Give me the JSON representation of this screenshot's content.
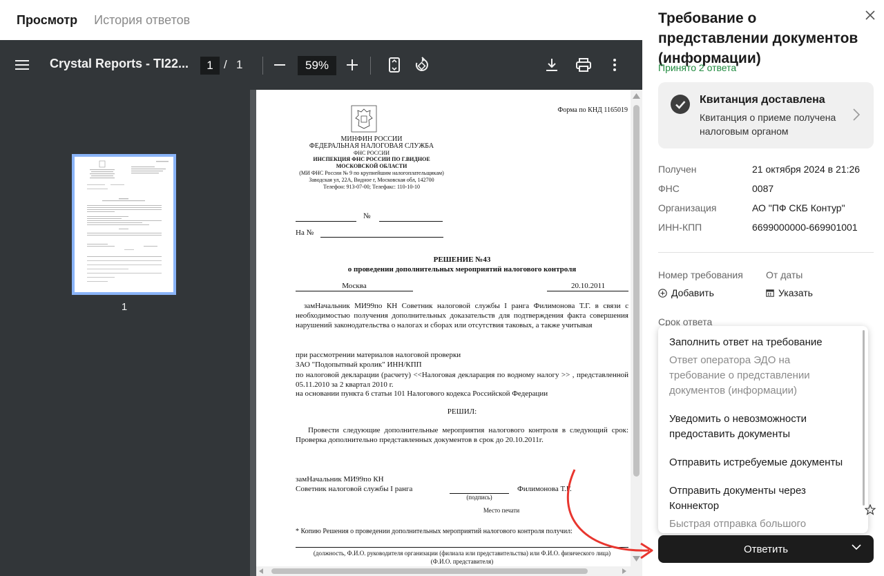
{
  "tabs": [
    {
      "label": "Просмотр",
      "active": true
    },
    {
      "label": "История ответов",
      "active": false
    }
  ],
  "viewer": {
    "title": "Crystal Reports - TI22...",
    "page_current": "1",
    "page_separator": "/",
    "page_total": "1",
    "zoom": "59%",
    "thumbnail_number": "1",
    "icons": [
      "menu-icon",
      "zoom-out-icon",
      "zoom-in-icon",
      "fit-page-icon",
      "rotate-icon",
      "download-icon",
      "print-icon",
      "more-icon"
    ]
  },
  "document": {
    "form_code": "Форма по КНД 1165019",
    "ministry": "МИНФИН РОССИИ",
    "service": "ФЕДЕРАЛЬНАЯ НАЛОГОВАЯ СЛУЖБА",
    "fns": "ФНС РОССИИ",
    "inspection_line1": "ИНСПЕКЦИЯ ФНС РОССИИ ПО Г.ВИДНОЕ",
    "inspection_line2": "МОСКОВСКОЙ ОБЛАСТИ",
    "inspection_line3": "(МИ ФНС России № 9  по крупнейшим налогоплательщикам)",
    "address": "Заводская ул, 22А, Видное г, Московская обл, 142700",
    "phone": "Телефон: 913-07-00; Телефакс: 110-10-10",
    "number_sign": "№",
    "to_label": "На  №",
    "decision_title": "РЕШЕНИЕ №43",
    "decision_subtitle": "о проведении дополнительных мероприятий налогового контроля",
    "city": "Москва",
    "date": "20.10.2011",
    "para1": "замНачальник МИ99по КН Советник налоговой службы I ранга Филимонова Т.Г. в связи с необходимостью получения дополнительных доказательств для подтверждения факта совершения нарушений законодательства о налогах и сборах  или отсутствия таковых, а также учитывая",
    "para2_line1": "при рассмотрении материалов налоговой проверки",
    "para2_line2": "ЗАО \"Подопытный кролик\"  ИНН/КПП",
    "para2_line3": "по налоговой декларации (расчету) <<Налоговая декларация по водному налогу >> , представленной  05.11.2010  за 2 квартал  2010 г.",
    "para2_line4": "на основании пункта 6 статьи 101 Налогового кодекса Российской Федерации",
    "resolved": "РЕШИЛ:",
    "para3": "Провести следующие дополнительные мероприятия налогового контроля в следующий срок: Проверка дополнительно представленных документов в срок до 20.10.2011г.",
    "signer_line1": "замНачальник МИ99по КН",
    "signer_line2": "Советник налоговой службы I ранга",
    "signer_name": "Филимонова Т.Г.",
    "signature_caption": "(подпись)",
    "stamp_place": "Место печати",
    "copy_note": "* Копию Решения о проведении дополнительных мероприятий налогового контроля получил:",
    "position_caption": "(должность, Ф.И.О. руководителя организации (филиала или представительства) или Ф.И.О. физического лица)",
    "rep_caption": "(Ф.И.О. представителя)"
  },
  "panel": {
    "title": "Требование о представлении документов (информации)",
    "accepted": "Принято 2 ответа",
    "receipt": {
      "title": "Квитанция доставлена",
      "subtitle": "Квитанция о приеме получена налоговым органом"
    },
    "info": [
      {
        "label": "Получен",
        "value": "21 октября 2024 в 21:26"
      },
      {
        "label": "ФНС",
        "value": "0087"
      },
      {
        "label": "Организация",
        "value": "АО \"ПФ СКБ Контур\""
      },
      {
        "label": "ИНН-КПП",
        "value": "6699000000-669901001"
      }
    ],
    "request_number_label": "Номер требования",
    "request_number_action": "Добавить",
    "date_label": "От даты",
    "date_action": "Указать",
    "deadline_label": "Срок ответа",
    "menu": [
      {
        "label": "Заполнить ответ на требование",
        "sub": "Ответ оператора ЭДО на требование о представлении документов (информации)"
      },
      {
        "label": "Уведомить о невозможности предоставить документы",
        "sub": ""
      },
      {
        "label": "Отправить истребуемые документы",
        "sub": ""
      },
      {
        "label": "Отправить документы через Коннектор",
        "sub": "Быстрая отправка большого"
      }
    ],
    "reply_button": "Ответить",
    "colors": {
      "accent_green": "#1f8a3e",
      "button_dark": "#1c1c1c",
      "arrow_red": "#e8362f"
    }
  }
}
